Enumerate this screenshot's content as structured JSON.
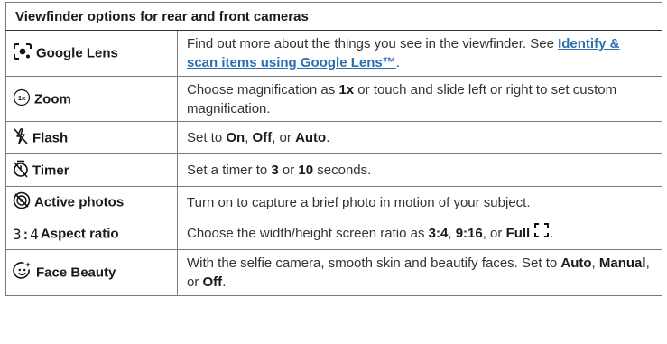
{
  "table": {
    "header": "Viewfinder options for rear and front cameras",
    "rows": [
      {
        "icon": "google-lens-icon",
        "label": "Google Lens",
        "desc_before": "Find out more about the things you see in the viewfinder. See ",
        "link": "Identify & scan items using Google Lens™",
        "desc_after": "."
      },
      {
        "icon": "zoom-1x-icon",
        "icon_text": "1x",
        "label": "Zoom",
        "desc": [
          "Choose magnification as ",
          "1x",
          " or touch and slide left or right to set custom magnification."
        ]
      },
      {
        "icon": "flash-off-icon",
        "label": "Flash",
        "desc": [
          "Set to ",
          "On",
          ", ",
          "Off",
          ", or ",
          "Auto",
          "."
        ]
      },
      {
        "icon": "timer-icon",
        "label": "Timer",
        "desc": [
          "Set a timer to ",
          "3",
          " or ",
          "10",
          " seconds."
        ]
      },
      {
        "icon": "active-photos-icon",
        "label": "Active photos",
        "desc": [
          "Turn on to capture a brief photo in motion of your subject."
        ]
      },
      {
        "icon": "aspect-ratio-icon",
        "icon_text": "3:4",
        "label": "Aspect ratio",
        "desc": [
          "Choose the width/height screen ratio as ",
          "3:4",
          ", ",
          "9:16",
          ", or ",
          "Full",
          "."
        ],
        "trailing_icon": "full-screen-icon"
      },
      {
        "icon": "face-beauty-icon",
        "label": "Face Beauty",
        "desc": [
          "With the selfie camera, smooth skin and beautify faces. Set to ",
          "Auto",
          ", ",
          "Manual",
          ", or ",
          "Off",
          "."
        ]
      }
    ]
  }
}
